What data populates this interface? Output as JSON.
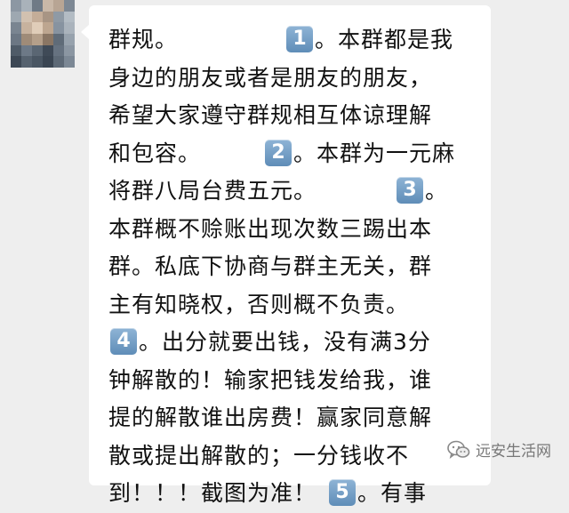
{
  "chat": {
    "message_lines": [
      {
        "pre": "群规。",
        "badge": "1",
        "post": "。本群都是我",
        "gap": 120
      },
      {
        "pre": "身边的朋友或者是朋友的朋友，",
        "badge": null,
        "post": "",
        "gap": 0
      },
      {
        "pre": "希望大家遵守群规相互体谅理解",
        "badge": null,
        "post": "",
        "gap": 0
      },
      {
        "pre": "和包容。",
        "badge": "2",
        "post": "。本群为一元麻",
        "gap": 70
      },
      {
        "pre": "将群八局台费五元。",
        "badge": "3",
        "post": "。",
        "gap": 88
      },
      {
        "pre": "本群概不赊账出现次数三踢出本",
        "badge": null,
        "post": "",
        "gap": 0
      },
      {
        "pre": "群。私底下协商与群主无关，群",
        "badge": null,
        "post": "",
        "gap": 0
      },
      {
        "pre": "主有知晓权，否则概不负责。",
        "badge": null,
        "post": "",
        "gap": 0
      },
      {
        "pre": "",
        "badge": "4",
        "post": "。出分就要出钱，没有满3分",
        "gap": 0
      },
      {
        "pre": "钟解散的！输家把钱发给我，谁",
        "badge": null,
        "post": "",
        "gap": 0
      },
      {
        "pre": "提的解散谁出房费！赢家同意解",
        "badge": null,
        "post": "",
        "gap": 0
      },
      {
        "pre": "散或提出解散的；一分钱收不",
        "badge": null,
        "post": "",
        "gap": 0
      },
      {
        "pre": "到！！！截图为准！",
        "badge": "5",
        "post": "。有事",
        "gap": 12
      }
    ]
  },
  "watermark": {
    "text": "远安生活网",
    "icon": "wechat-icon"
  },
  "colors": {
    "background": "#eeeeee",
    "bubble": "#ffffff",
    "badge": "#6f9bc4"
  }
}
